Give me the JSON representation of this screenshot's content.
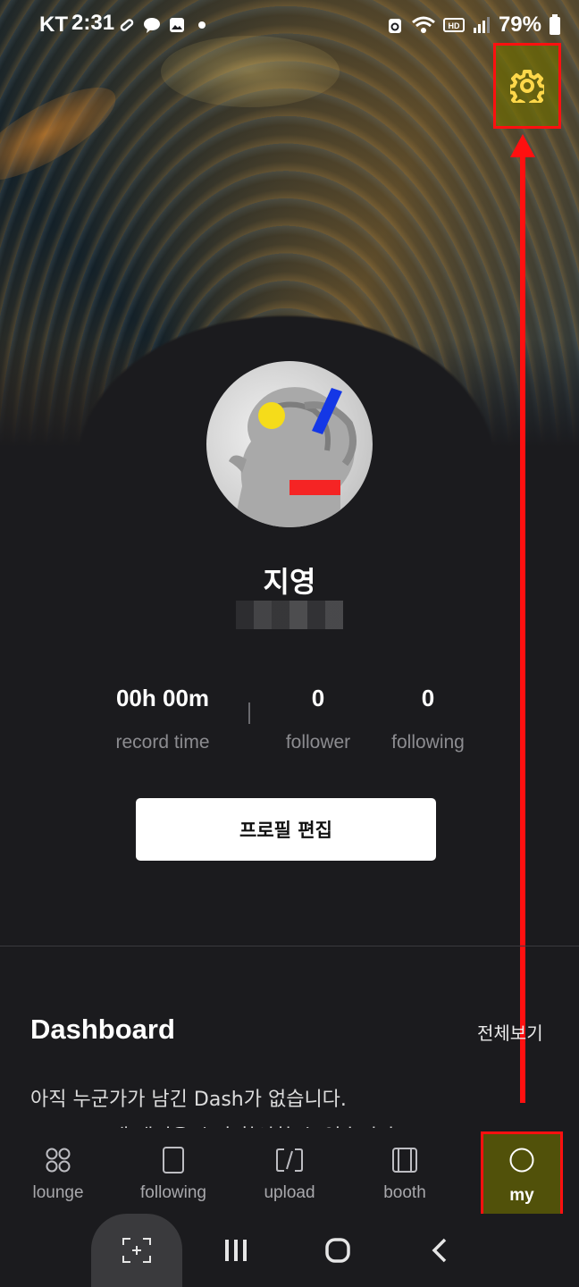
{
  "status_bar": {
    "carrier": "KT",
    "time": "2:31",
    "battery": "79%",
    "icons": [
      "pill-icon",
      "talk-icon",
      "gallery-icon",
      "dot-icon",
      "sync-icon",
      "wifi-icon",
      "hd-icon",
      "signal-icon",
      "battery-icon"
    ]
  },
  "profile": {
    "name": "지영",
    "stats": [
      {
        "value": "00h 00m",
        "label": "record time"
      },
      {
        "value": "0",
        "label": "follower"
      },
      {
        "value": "0",
        "label": "following"
      }
    ],
    "edit_label": "프로필 편집"
  },
  "dashboard": {
    "title": "Dashboard",
    "see_all": "전체보기",
    "empty_line1": "아직 누군가가 남긴 Dash가 없습니다.",
    "empty_line2": "Dash 고 내 배경을 수가 확인할 수 있습니다"
  },
  "bottom_nav": {
    "items": [
      {
        "label": "lounge",
        "icon": "lounge-icon"
      },
      {
        "label": "following",
        "icon": "following-icon"
      },
      {
        "label": "upload",
        "icon": "upload-icon"
      },
      {
        "label": "booth",
        "icon": "booth-icon"
      },
      {
        "label": "my",
        "icon": "my-icon"
      }
    ],
    "active": "my"
  },
  "colors": {
    "background": "#1b1b1e",
    "highlight_border": "#ff1010",
    "highlight_fill": "#6e6e00"
  }
}
